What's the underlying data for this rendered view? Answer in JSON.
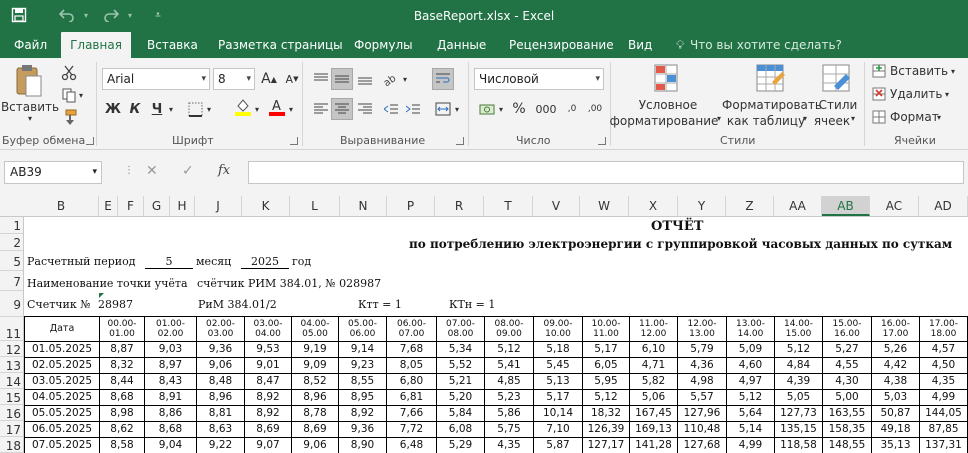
{
  "window": {
    "title": "BaseReport.xlsx - Excel"
  },
  "ribbon": {
    "tabs": [
      "Файл",
      "Главная",
      "Вставка",
      "Разметка страницы",
      "Формулы",
      "Данные",
      "Рецензирование",
      "Вид"
    ],
    "active_tab": "Главная",
    "tell_me": "Что вы хотите сделать?",
    "clipboard": {
      "label": "Буфер обмена",
      "paste": "Вставить"
    },
    "font": {
      "label": "Шрифт",
      "name": "Arial",
      "size": "8",
      "bold": "Ж",
      "italic": "К",
      "underline": "Ч",
      "grow": "A",
      "shrink": "A"
    },
    "alignment": {
      "label": "Выравнивание"
    },
    "number": {
      "label": "Число",
      "format": "Числовой",
      "percent": "%",
      "thousands": "000",
      "inc_decimal": ",0",
      "dec_decimal": ",00"
    },
    "styles": {
      "label": "Стили",
      "conditional_1": "Условное",
      "conditional_2": "форматирование",
      "table_1": "Форматировать",
      "table_2": "как таблицу",
      "cell_1": "Стили",
      "cell_2": "ячеек"
    },
    "cells": {
      "label": "Ячейки",
      "insert": "Вставить",
      "delete": "Удалить",
      "format": "Формат"
    },
    "colors": {
      "highlight": "#ffff00",
      "font_color": "#ff0000",
      "brand": "#217346"
    }
  },
  "formula_bar": {
    "name_box": "AB39",
    "fx": "fx",
    "cancel": "✕",
    "enter": "✓",
    "content": ""
  },
  "columns": [
    "B",
    "E",
    "F",
    "G",
    "H",
    "J",
    "K",
    "L",
    "N",
    "P",
    "R",
    "T",
    "V",
    "W",
    "X",
    "Y",
    "Z",
    "AA",
    "AB",
    "AC",
    "AD"
  ],
  "selected_column": "AB",
  "rows": [
    "1",
    "2",
    "5",
    "7",
    "9",
    "11",
    "12",
    "13",
    "14",
    "15",
    "16",
    "17",
    "18"
  ],
  "report": {
    "title": "ОТЧЁТ",
    "subtitle": "по потреблению электроэнергии с группировкой часовых данных по суткам",
    "period_label": "Расчетный период",
    "period_value": "5",
    "month_label": "месяц",
    "year_value": "2025",
    "year_label": "год",
    "point_label": "Наименование  точки  учёта",
    "point_value": "счётчик РИМ 384.01, № 028987",
    "meter_label": "Счетчик №",
    "meter_value": "28987",
    "meter_model": "РиМ 384.01/2",
    "ktt": "Ктт =  1",
    "ktn": "КТн =  1"
  },
  "table": {
    "headers": [
      "Дата",
      "00.00-\n01.00",
      "01.00-\n02.00",
      "02.00-\n03.00",
      "03.00-\n04.00",
      "04.00-\n05.00",
      "05.00-\n06.00",
      "06.00-\n07.00",
      "07.00-\n08.00",
      "08.00-\n09.00",
      "09.00-\n10.00",
      "10.00-\n11.00",
      "11.00-\n12.00",
      "12.00-\n13.00",
      "13.00-\n14.00",
      "14.00-\n15.00",
      "15.00-\n16.00",
      "16.00-\n17.00",
      "17.00-\n18.00"
    ],
    "rows": [
      [
        "01.05.2025",
        "8,87",
        "9,03",
        "9,36",
        "9,53",
        "9,19",
        "9,14",
        "7,68",
        "5,34",
        "5,12",
        "5,18",
        "5,17",
        "6,10",
        "5,79",
        "5,09",
        "5,12",
        "5,27",
        "5,26",
        "4,57"
      ],
      [
        "02.05.2025",
        "8,32",
        "8,97",
        "9,06",
        "9,01",
        "9,09",
        "9,23",
        "8,05",
        "5,52",
        "5,41",
        "5,45",
        "6,05",
        "4,71",
        "4,36",
        "4,60",
        "4,84",
        "4,55",
        "4,42",
        "4,50"
      ],
      [
        "03.05.2025",
        "8,44",
        "8,43",
        "8,48",
        "8,47",
        "8,52",
        "8,55",
        "6,80",
        "5,21",
        "4,85",
        "5,13",
        "5,95",
        "5,82",
        "4,98",
        "4,97",
        "4,39",
        "4,30",
        "4,38",
        "4,35"
      ],
      [
        "04.05.2025",
        "8,68",
        "8,91",
        "8,96",
        "8,92",
        "8,96",
        "8,95",
        "6,81",
        "5,20",
        "5,23",
        "5,17",
        "5,12",
        "5,06",
        "5,57",
        "5,12",
        "5,05",
        "5,00",
        "5,03",
        "4,99"
      ],
      [
        "05.05.2025",
        "8,98",
        "8,86",
        "8,81",
        "8,92",
        "8,78",
        "8,92",
        "7,66",
        "5,84",
        "5,86",
        "10,14",
        "18,32",
        "167,45",
        "127,96",
        "5,64",
        "127,73",
        "163,55",
        "50,87",
        "144,05"
      ],
      [
        "06.05.2025",
        "8,62",
        "8,68",
        "8,63",
        "8,69",
        "8,69",
        "9,36",
        "7,72",
        "6,08",
        "5,75",
        "7,10",
        "126,39",
        "169,13",
        "110,48",
        "5,14",
        "135,15",
        "158,35",
        "49,18",
        "87,85"
      ],
      [
        "07.05.2025",
        "8,58",
        "9,04",
        "9,22",
        "9,07",
        "9,06",
        "8,90",
        "6,48",
        "5,29",
        "4,35",
        "5,87",
        "127,17",
        "141,28",
        "127,68",
        "4,99",
        "118,58",
        "148,55",
        "35,13",
        "137,31"
      ]
    ]
  }
}
